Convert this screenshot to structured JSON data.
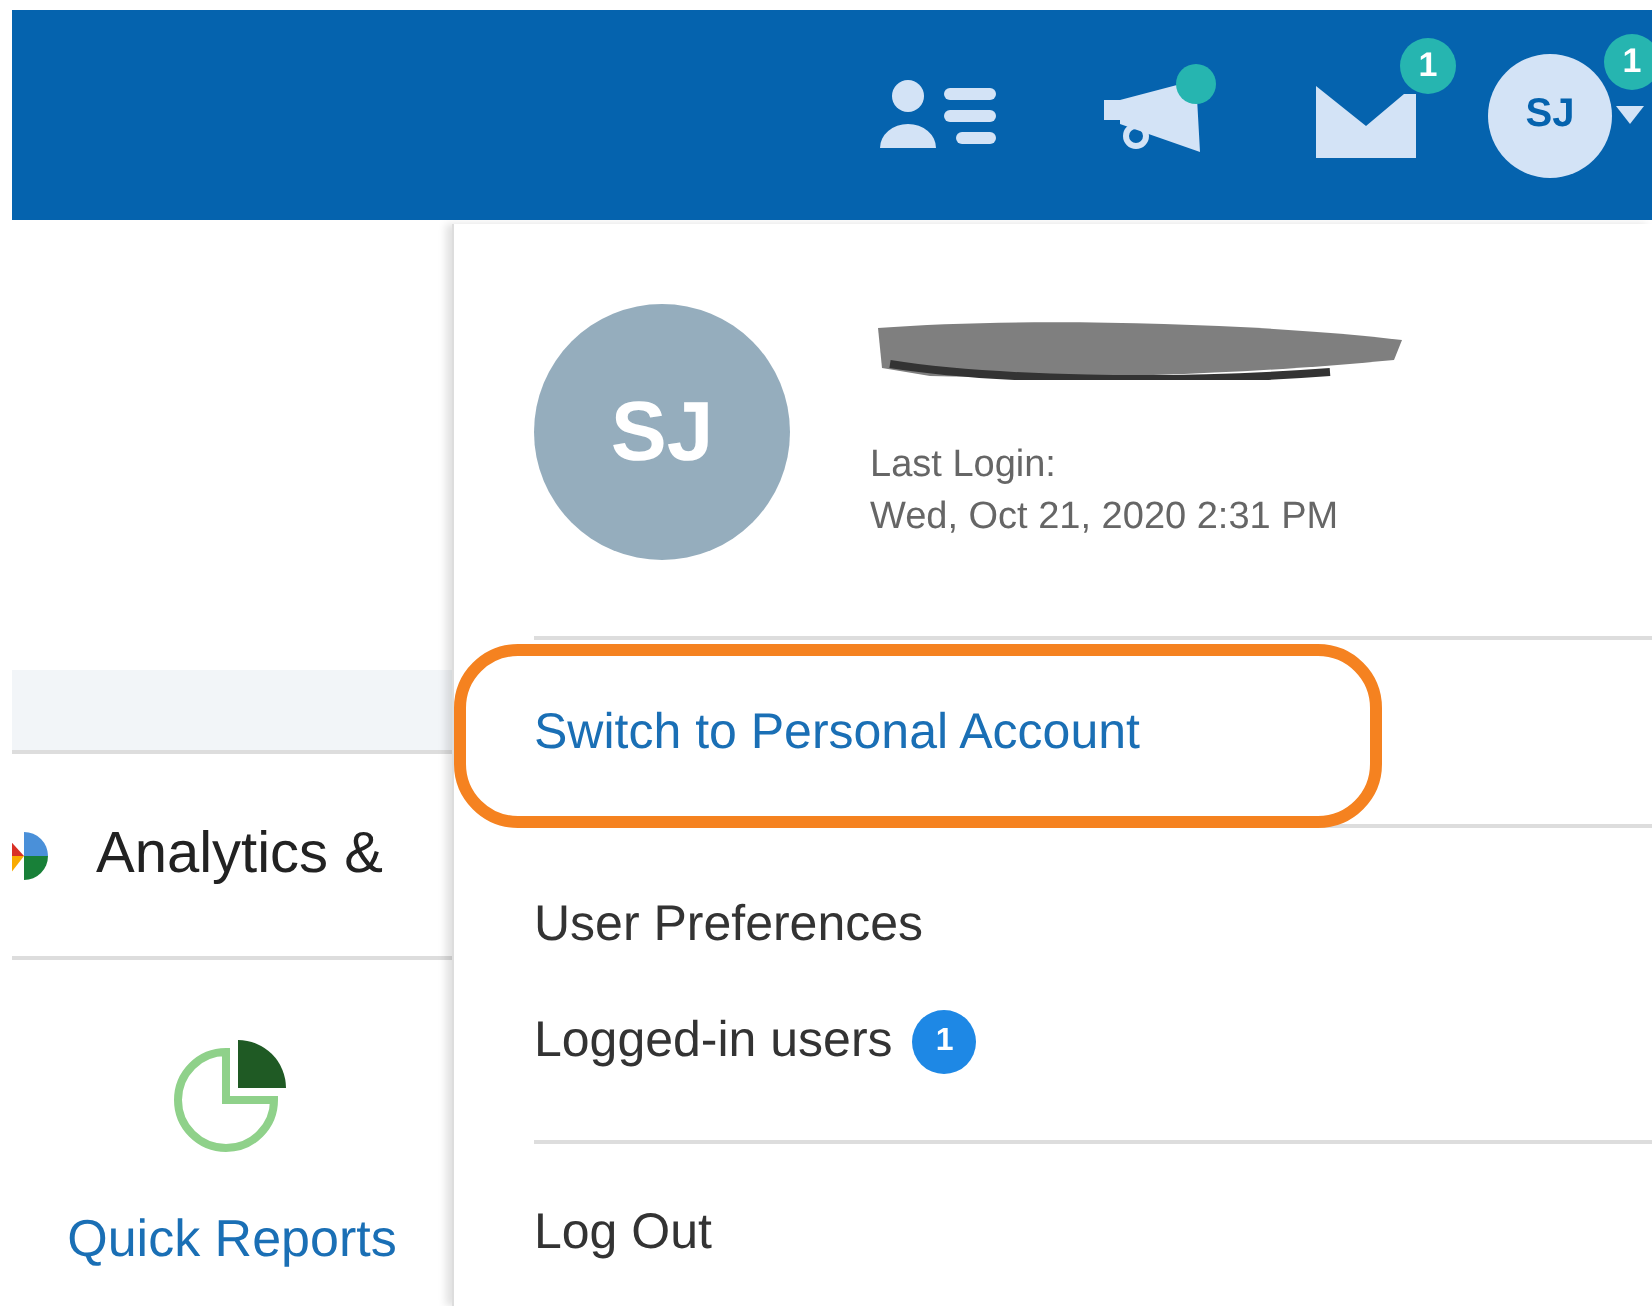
{
  "header": {
    "announcements": {
      "has_new": true
    },
    "mail": {
      "badge": "1"
    },
    "user": {
      "initials": "SJ",
      "badge": "1"
    }
  },
  "sidebar": {
    "items": [
      {
        "kind": "row",
        "label": "Analytics &"
      },
      {
        "kind": "tile",
        "label": "Quick Reports"
      }
    ]
  },
  "user_menu": {
    "avatar": "SJ",
    "name_redacted": true,
    "last_login_label": "Last Login:",
    "last_login": "Wed, Oct 21, 2020 2:31 PM",
    "items": [
      {
        "label": "Switch to Personal Account",
        "kind": "link",
        "highlighted": true
      },
      {
        "label": "User Preferences",
        "kind": "item",
        "highlighted": false
      },
      {
        "label": "Logged-in users",
        "kind": "item",
        "badge": "1",
        "highlighted": false
      },
      {
        "label": "Log Out",
        "kind": "item",
        "highlighted": false
      }
    ]
  }
}
